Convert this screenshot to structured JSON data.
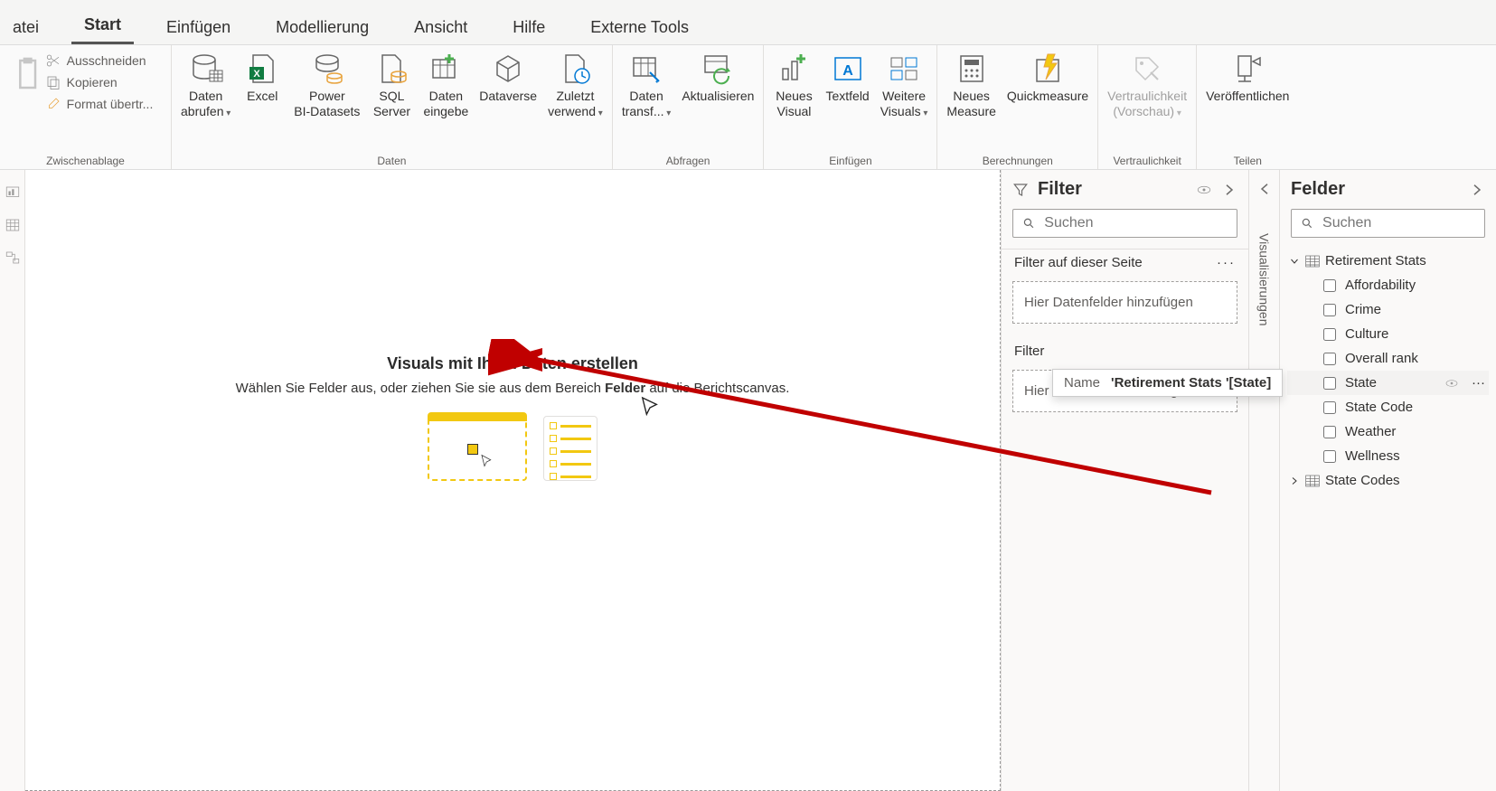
{
  "tabs": [
    "atei",
    "Start",
    "Einfügen",
    "Modellierung",
    "Ansicht",
    "Hilfe",
    "Externe Tools"
  ],
  "activeTab": "Start",
  "clipboard": {
    "group": "Zwischenablage",
    "cut": "Ausschneiden",
    "copy": "Kopieren",
    "format": "Format übertr..."
  },
  "ribbon": {
    "daten": {
      "group": "Daten",
      "get": "Daten\nabrufen",
      "excel": "Excel",
      "pbds": "Power\nBI-Datasets",
      "sql": "SQL\nServer",
      "entry": "Daten\neingebe",
      "dataverse": "Dataverse",
      "recent": "Zuletzt\nverwend"
    },
    "abfragen": {
      "group": "Abfragen",
      "transform": "Daten\ntransf...",
      "refresh": "Aktualisieren"
    },
    "einfuegen": {
      "group": "Einfügen",
      "newvis": "Neues\nVisual",
      "textbox": "Textfeld",
      "more": "Weitere\nVisuals"
    },
    "berechnungen": {
      "group": "Berechnungen",
      "newmeasure": "Neues\nMeasure",
      "quick": "Quickmeasure"
    },
    "vertraulichkeit": {
      "group": "Vertraulichkeit",
      "label": "Vertraulichkeit\n(Vorschau)"
    },
    "teilen": {
      "group": "Teilen",
      "publish": "Veröffentlichen"
    }
  },
  "canvas": {
    "title": "Visuals mit Ihren Daten erstellen",
    "sub_pre": "Wählen Sie Felder aus, oder ziehen Sie sie aus dem Bereich ",
    "sub_bold": "Felder",
    "sub_post": " auf die Berichtscanvas."
  },
  "filter": {
    "title": "Filter",
    "search": "Suchen",
    "pageTitle": "Filter auf dieser Seite",
    "dropHint": "Hier Datenfelder hinzufügen",
    "allPages": "Filter"
  },
  "visualizations": "Visualisierungen",
  "fieldsPane": {
    "title": "Felder",
    "search": "Suchen",
    "tables": [
      {
        "name": "Retirement Stats",
        "expanded": true,
        "fields": [
          "Affordability",
          "Crime",
          "Culture",
          "Overall rank",
          "State",
          "State Code",
          "Weather",
          "Wellness"
        ]
      },
      {
        "name": "State Codes",
        "expanded": false,
        "fields": []
      }
    ]
  },
  "tooltip": {
    "key": "Name",
    "value": "'Retirement Stats '[State]"
  }
}
